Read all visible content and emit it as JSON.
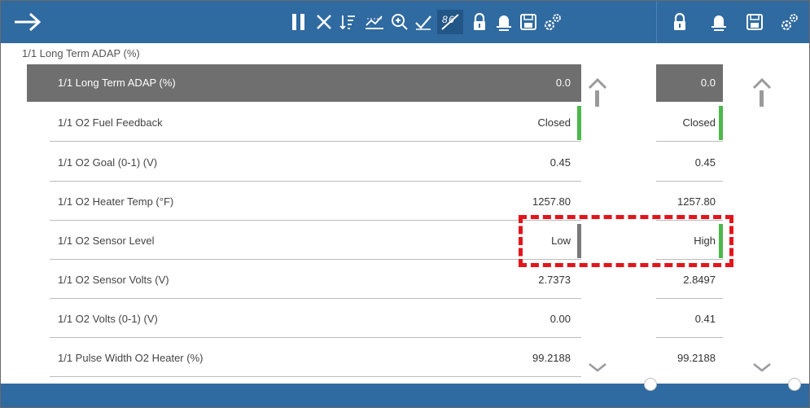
{
  "toolbar": {
    "back_icon": "arrow-right-icon",
    "icons": [
      "pause-icon",
      "clear-icon",
      "sort-icon",
      "graph-scale-icon",
      "zoom-icon",
      "select-icon",
      "compare-icon",
      "lock-icon",
      "bell-icon",
      "save-icon",
      "settings-icon",
      "lock-icon",
      "bell-icon",
      "save-icon",
      "settings-icon"
    ],
    "color": "#2f6aa1"
  },
  "param_title": "1/1 Long Term ADAP (%)",
  "rows": [
    {
      "name": "1/1 Long Term ADAP (%)",
      "value": "0.0",
      "compare": "0.0"
    },
    {
      "name": "1/1 O2 Fuel Feedback",
      "value": "Closed",
      "compare": "Closed"
    },
    {
      "name": "1/1 O2 Goal (0-1) (V)",
      "value": "0.45",
      "compare": "0.45"
    },
    {
      "name": "1/1 O2 Heater Temp (°F)",
      "value": "1257.80",
      "compare": "1257.80"
    },
    {
      "name": "1/1 O2 Sensor Level",
      "value": "Low",
      "compare": "High"
    },
    {
      "name": "1/1 O2 Sensor Volts (V)",
      "value": "2.7373",
      "compare": "2.8497"
    },
    {
      "name": "1/1 O2 Volts (0-1) (V)",
      "value": "0.00",
      "compare": "0.41"
    },
    {
      "name": "1/1 Pulse Width O2 Heater (%)",
      "value": "99.2188",
      "compare": "99.2188"
    }
  ],
  "marker_colors": {
    "green": "#4cb84c",
    "gray": "#7a7a7a"
  }
}
